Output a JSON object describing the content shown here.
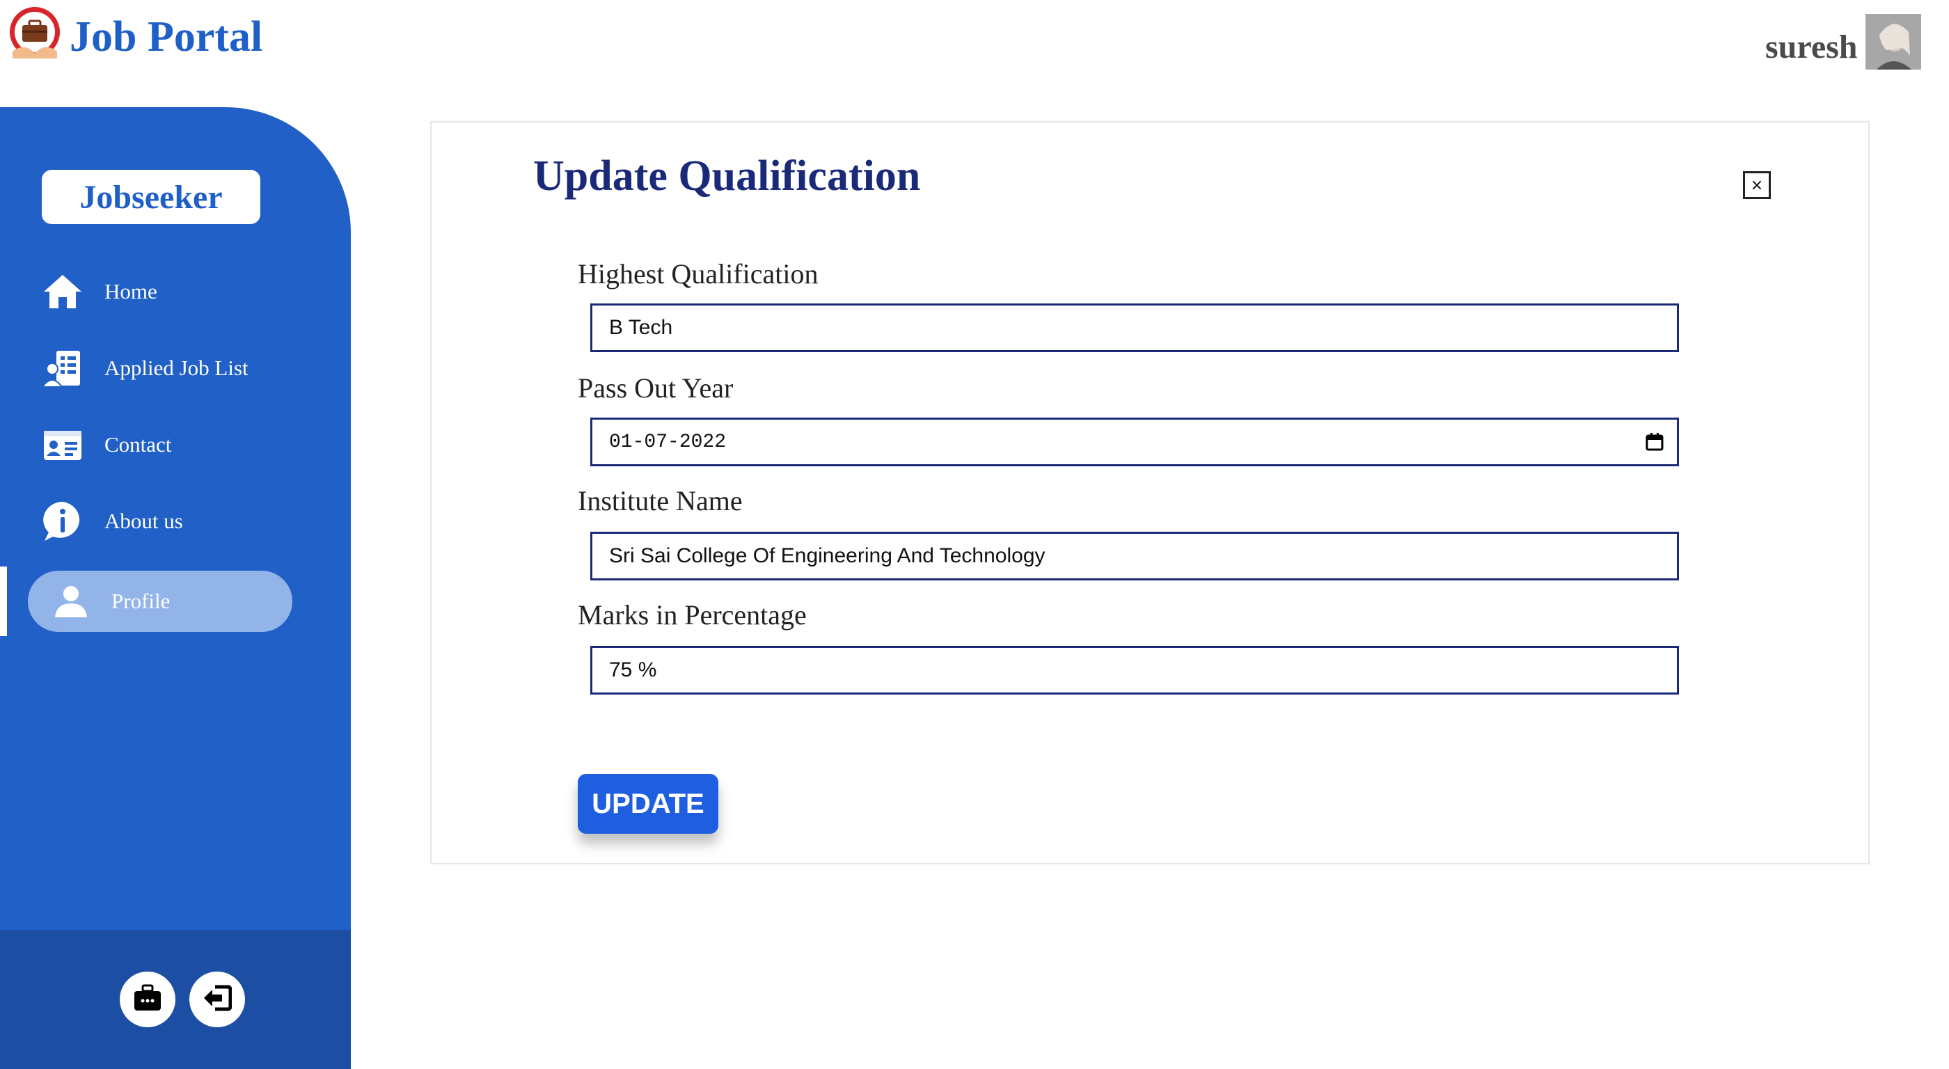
{
  "header": {
    "app_title": "Job Portal",
    "user_name": "suresh"
  },
  "sidebar": {
    "role_label": "Jobseeker",
    "items": [
      {
        "label": "Home",
        "icon": "home-icon"
      },
      {
        "label": "Applied Job List",
        "icon": "applied-list-icon"
      },
      {
        "label": "Contact",
        "icon": "contact-card-icon"
      },
      {
        "label": "About us",
        "icon": "info-icon"
      },
      {
        "label": "Profile",
        "icon": "user-icon",
        "active": true
      }
    ],
    "footer_buttons": [
      {
        "icon": "briefcase-icon"
      },
      {
        "icon": "logout-icon"
      }
    ]
  },
  "form": {
    "title": "Update Qualification",
    "close_label": "×",
    "fields": [
      {
        "label": "Highest Qualification",
        "value": "B Tech"
      },
      {
        "label": "Pass Out Year",
        "value": "01-07-2022"
      },
      {
        "label": "Institute Name",
        "value": "Sri Sai College Of Engineering And Technology"
      },
      {
        "label": "Marks in Percentage",
        "value": "75 %"
      }
    ],
    "submit_label": "UPDATE"
  },
  "colors": {
    "brand_blue": "#1f5fc8",
    "sidebar_blue": "#2060c7",
    "sidebar_footer": "#1c4fa3",
    "title_navy": "#1b2a78",
    "button_blue": "#1f5fdf",
    "active_pill": "#92b4e8"
  }
}
